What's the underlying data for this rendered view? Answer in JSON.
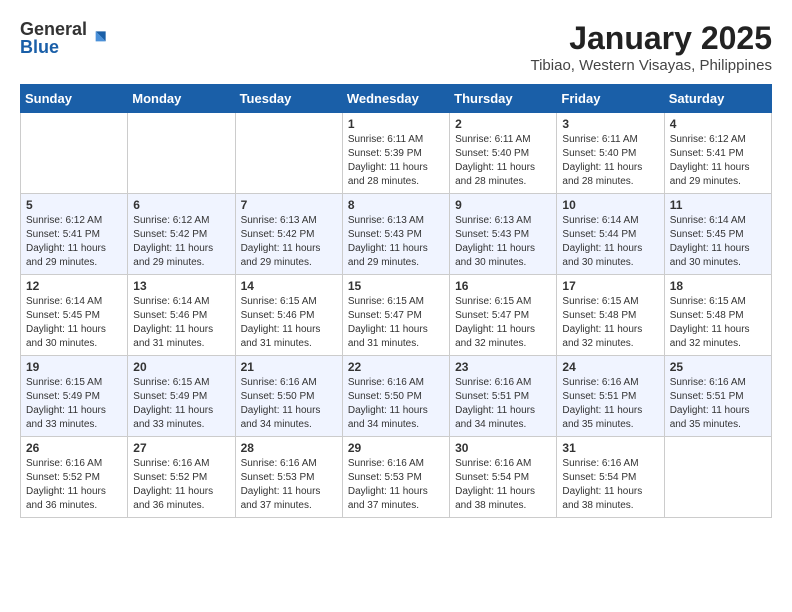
{
  "logo": {
    "general": "General",
    "blue": "Blue"
  },
  "header": {
    "title": "January 2025",
    "subtitle": "Tibiao, Western Visayas, Philippines"
  },
  "weekdays": [
    "Sunday",
    "Monday",
    "Tuesday",
    "Wednesday",
    "Thursday",
    "Friday",
    "Saturday"
  ],
  "weeks": [
    [
      {
        "day": "",
        "info": ""
      },
      {
        "day": "",
        "info": ""
      },
      {
        "day": "",
        "info": ""
      },
      {
        "day": "1",
        "info": "Sunrise: 6:11 AM\nSunset: 5:39 PM\nDaylight: 11 hours\nand 28 minutes."
      },
      {
        "day": "2",
        "info": "Sunrise: 6:11 AM\nSunset: 5:40 PM\nDaylight: 11 hours\nand 28 minutes."
      },
      {
        "day": "3",
        "info": "Sunrise: 6:11 AM\nSunset: 5:40 PM\nDaylight: 11 hours\nand 28 minutes."
      },
      {
        "day": "4",
        "info": "Sunrise: 6:12 AM\nSunset: 5:41 PM\nDaylight: 11 hours\nand 29 minutes."
      }
    ],
    [
      {
        "day": "5",
        "info": "Sunrise: 6:12 AM\nSunset: 5:41 PM\nDaylight: 11 hours\nand 29 minutes."
      },
      {
        "day": "6",
        "info": "Sunrise: 6:12 AM\nSunset: 5:42 PM\nDaylight: 11 hours\nand 29 minutes."
      },
      {
        "day": "7",
        "info": "Sunrise: 6:13 AM\nSunset: 5:42 PM\nDaylight: 11 hours\nand 29 minutes."
      },
      {
        "day": "8",
        "info": "Sunrise: 6:13 AM\nSunset: 5:43 PM\nDaylight: 11 hours\nand 29 minutes."
      },
      {
        "day": "9",
        "info": "Sunrise: 6:13 AM\nSunset: 5:43 PM\nDaylight: 11 hours\nand 30 minutes."
      },
      {
        "day": "10",
        "info": "Sunrise: 6:14 AM\nSunset: 5:44 PM\nDaylight: 11 hours\nand 30 minutes."
      },
      {
        "day": "11",
        "info": "Sunrise: 6:14 AM\nSunset: 5:45 PM\nDaylight: 11 hours\nand 30 minutes."
      }
    ],
    [
      {
        "day": "12",
        "info": "Sunrise: 6:14 AM\nSunset: 5:45 PM\nDaylight: 11 hours\nand 30 minutes."
      },
      {
        "day": "13",
        "info": "Sunrise: 6:14 AM\nSunset: 5:46 PM\nDaylight: 11 hours\nand 31 minutes."
      },
      {
        "day": "14",
        "info": "Sunrise: 6:15 AM\nSunset: 5:46 PM\nDaylight: 11 hours\nand 31 minutes."
      },
      {
        "day": "15",
        "info": "Sunrise: 6:15 AM\nSunset: 5:47 PM\nDaylight: 11 hours\nand 31 minutes."
      },
      {
        "day": "16",
        "info": "Sunrise: 6:15 AM\nSunset: 5:47 PM\nDaylight: 11 hours\nand 32 minutes."
      },
      {
        "day": "17",
        "info": "Sunrise: 6:15 AM\nSunset: 5:48 PM\nDaylight: 11 hours\nand 32 minutes."
      },
      {
        "day": "18",
        "info": "Sunrise: 6:15 AM\nSunset: 5:48 PM\nDaylight: 11 hours\nand 32 minutes."
      }
    ],
    [
      {
        "day": "19",
        "info": "Sunrise: 6:15 AM\nSunset: 5:49 PM\nDaylight: 11 hours\nand 33 minutes."
      },
      {
        "day": "20",
        "info": "Sunrise: 6:15 AM\nSunset: 5:49 PM\nDaylight: 11 hours\nand 33 minutes."
      },
      {
        "day": "21",
        "info": "Sunrise: 6:16 AM\nSunset: 5:50 PM\nDaylight: 11 hours\nand 34 minutes."
      },
      {
        "day": "22",
        "info": "Sunrise: 6:16 AM\nSunset: 5:50 PM\nDaylight: 11 hours\nand 34 minutes."
      },
      {
        "day": "23",
        "info": "Sunrise: 6:16 AM\nSunset: 5:51 PM\nDaylight: 11 hours\nand 34 minutes."
      },
      {
        "day": "24",
        "info": "Sunrise: 6:16 AM\nSunset: 5:51 PM\nDaylight: 11 hours\nand 35 minutes."
      },
      {
        "day": "25",
        "info": "Sunrise: 6:16 AM\nSunset: 5:51 PM\nDaylight: 11 hours\nand 35 minutes."
      }
    ],
    [
      {
        "day": "26",
        "info": "Sunrise: 6:16 AM\nSunset: 5:52 PM\nDaylight: 11 hours\nand 36 minutes."
      },
      {
        "day": "27",
        "info": "Sunrise: 6:16 AM\nSunset: 5:52 PM\nDaylight: 11 hours\nand 36 minutes."
      },
      {
        "day": "28",
        "info": "Sunrise: 6:16 AM\nSunset: 5:53 PM\nDaylight: 11 hours\nand 37 minutes."
      },
      {
        "day": "29",
        "info": "Sunrise: 6:16 AM\nSunset: 5:53 PM\nDaylight: 11 hours\nand 37 minutes."
      },
      {
        "day": "30",
        "info": "Sunrise: 6:16 AM\nSunset: 5:54 PM\nDaylight: 11 hours\nand 38 minutes."
      },
      {
        "day": "31",
        "info": "Sunrise: 6:16 AM\nSunset: 5:54 PM\nDaylight: 11 hours\nand 38 minutes."
      },
      {
        "day": "",
        "info": ""
      }
    ]
  ]
}
